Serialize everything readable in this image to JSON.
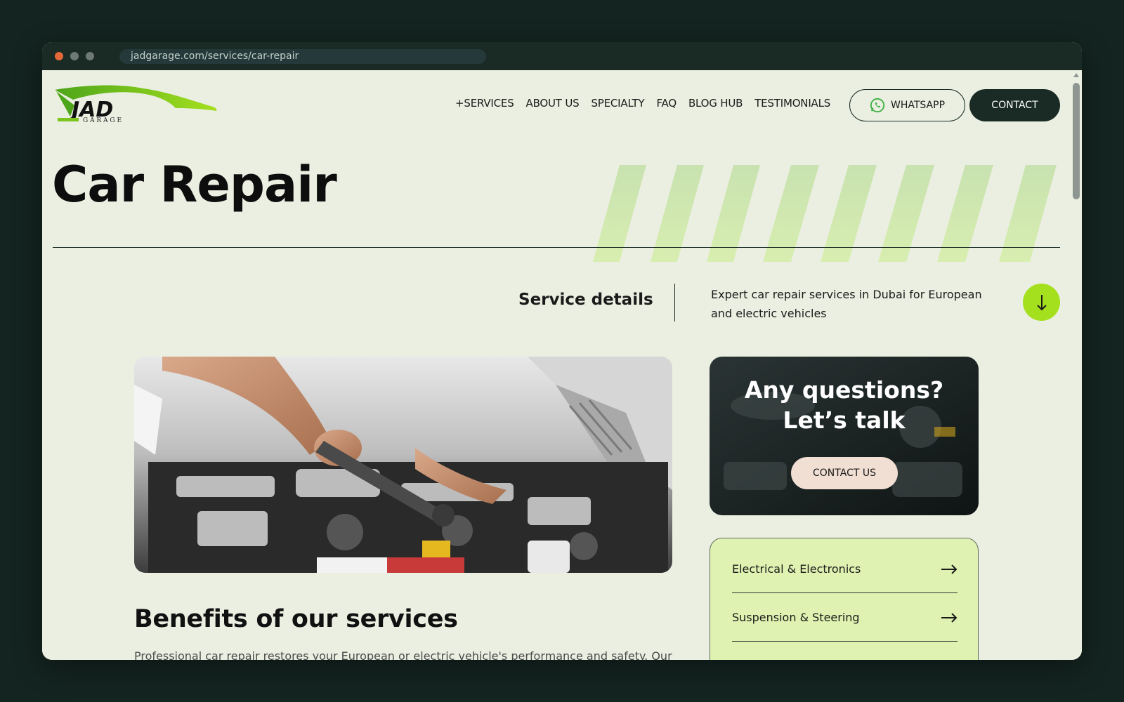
{
  "browser": {
    "url": "jadgarage.com/services/car-repair"
  },
  "header": {
    "logo_text": "JAD",
    "logo_sub": "G A R A G E",
    "nav": [
      "+SERVICES",
      "ABOUT US",
      "SPECIALTY",
      "FAQ",
      "BLOG HUB",
      "TESTIMONIALS"
    ],
    "whatsapp_label": "WHATSAPP",
    "contact_label": "CONTACT"
  },
  "main": {
    "title": "Car Repair",
    "service_details_label": "Service details",
    "service_description": "Expert car repair services in Dubai for European and electric vehicles",
    "benefits_title": "Benefits of our services",
    "benefits_text": "Professional car repair restores your European or electric vehicle's performance and safety. Our"
  },
  "sidebar": {
    "cta_title": "Any questions?\nLet’s talk",
    "cta_button": "CONTACT US",
    "services": [
      "Electrical & Electronics",
      "Suspension & Steering"
    ]
  },
  "colors": {
    "background": "#ebefe1",
    "dark": "#1a2b26",
    "accent_lime": "#a5e01f",
    "card_lime": "#dff2b1",
    "cta_button": "#f2dfd3"
  },
  "icons": {
    "whatsapp": "whatsapp-icon",
    "down": "arrow-down-icon",
    "list_arrow": "arrow-right-icon"
  }
}
